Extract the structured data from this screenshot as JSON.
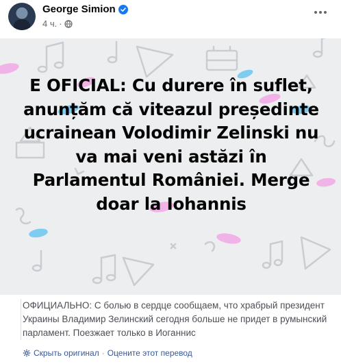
{
  "post": {
    "author": "George Simion",
    "time": "4 ч.",
    "meta_separator": "·",
    "text": "E OFICIAL: Cu durere în suflet, anunțăm că viteazul președinte ucrainean Volodimir Zelinski nu va mai veni astăzi în Parlamentul României. Merge doar la Iohannis",
    "background_color": "#eceeef",
    "accent_pink": "#f2a8e6",
    "accent_blue": "#6bc6f0"
  },
  "translation": {
    "text": "ОФИЦИАЛЬНО: С болью в сердце сообщаем, что храбрый президент Украины Владимир Зелинский сегодня больше не придет в румынский парламент. Поезжает только в Иоганнис",
    "hide_original_label": "Скрыть оригинал",
    "rate_label": "Оцените этот перевод",
    "separator": "·",
    "link_color": "#385898"
  },
  "icons": [
    "verified-icon",
    "globe-icon",
    "more-icon",
    "gear-icon"
  ]
}
